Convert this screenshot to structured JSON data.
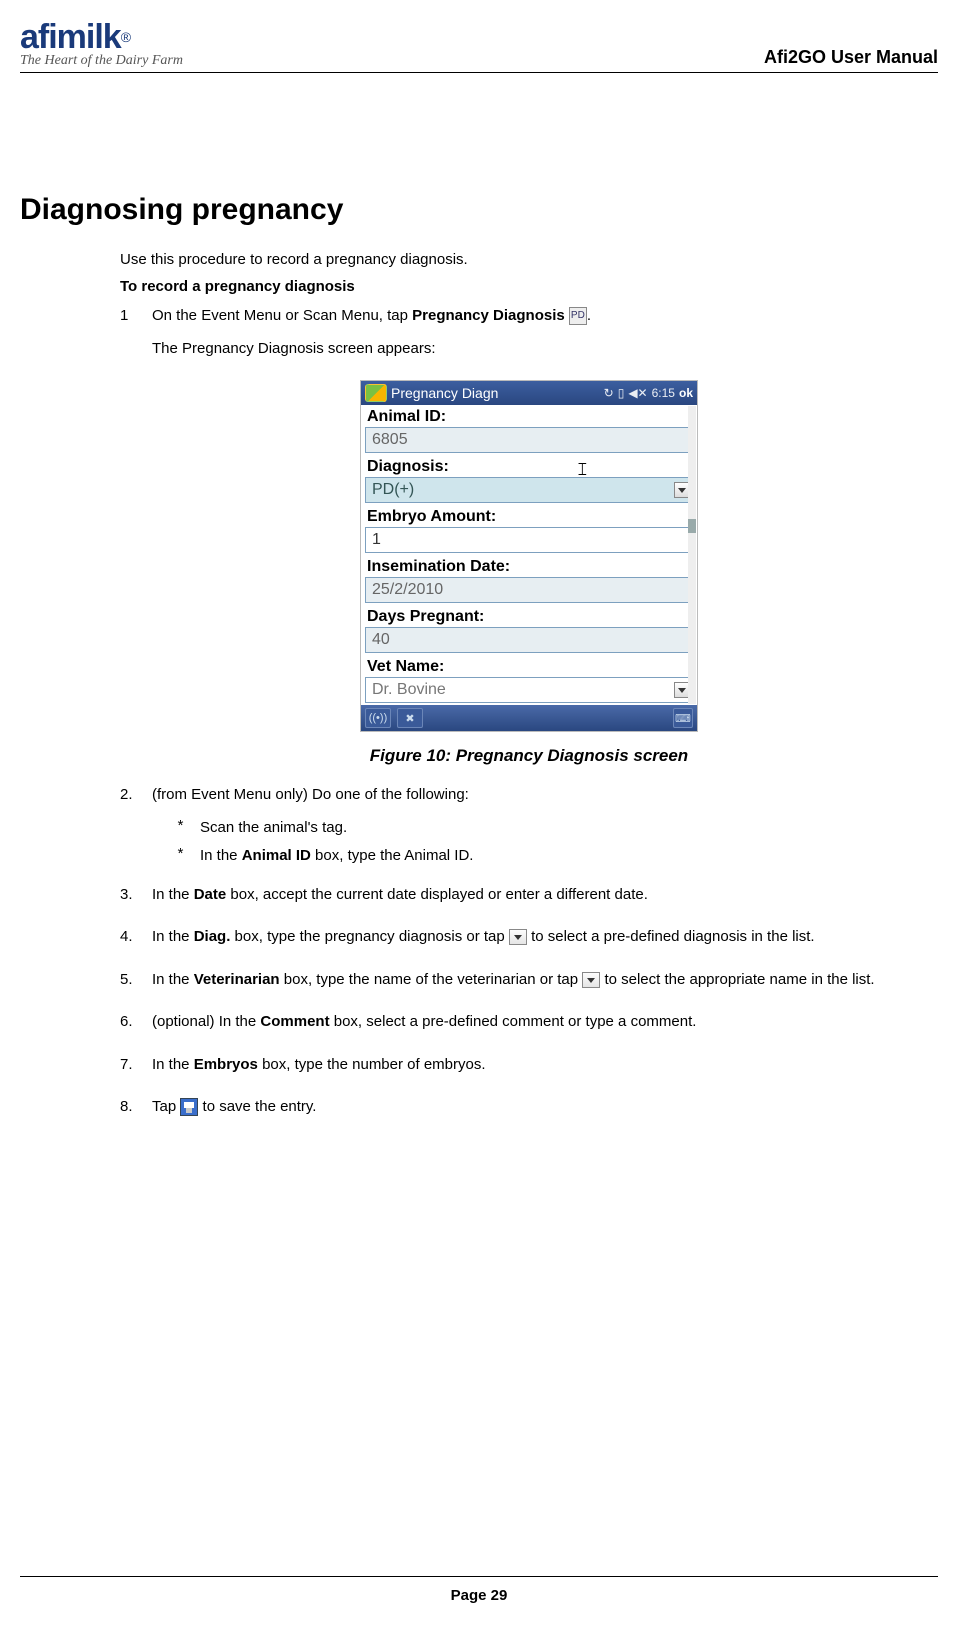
{
  "header": {
    "logo_text": "afimilk",
    "logo_reg": "®",
    "logo_tagline": "The Heart of the Dairy Farm",
    "doc_title": "Afi2GO User Manual"
  },
  "main": {
    "h1": "Diagnosing pregnancy",
    "intro": "Use this procedure to record a pregnancy diagnosis.",
    "subhead": "To record a pregnancy diagnosis",
    "step1_num": "1",
    "step1_pre": "On the Event Menu or Scan Menu, tap ",
    "step1_bold": "Pregnancy Diagnosis ",
    "step1_icon_label": "PD",
    "step1_post": ".",
    "step1_line2": "The Pregnancy Diagnosis screen appears:",
    "caption": "Figure 10: Pregnancy Diagnosis screen",
    "step2_num": "2.",
    "step2_text": "(from Event Menu only) Do one of the following:",
    "step2_b1": "Scan the animal's tag.",
    "step2_b2_pre": "In the ",
    "step2_b2_bold": "Animal ID",
    "step2_b2_post": " box, type the Animal ID.",
    "step3_num": "3.",
    "step3_pre": "In the ",
    "step3_bold": "Date",
    "step3_post": " box, accept the current date displayed or enter a different date.",
    "step4_num": "4.",
    "step4_pre": "In the ",
    "step4_bold": "Diag.",
    "step4_mid": " box, type the pregnancy diagnosis or tap ",
    "step4_post": " to select a pre-defined diagnosis in the list.",
    "step5_num": "5.",
    "step5_pre": "In the ",
    "step5_bold": "Veterinarian",
    "step5_mid": " box, type the name of the veterinarian or tap ",
    "step5_post": " to select the appropriate name in the list.",
    "step6_num": "6.",
    "step6_pre": "(optional) In the ",
    "step6_bold": "Comment",
    "step6_post": " box, select a pre-defined comment or type a comment.",
    "step7_num": "7.",
    "step7_pre": "In the ",
    "step7_bold": "Embryos",
    "step7_post": " box, type the number of embryos.",
    "step8_num": "8.",
    "step8_pre": "Tap ",
    "step8_post": " to save the entry."
  },
  "screenshot": {
    "titlebar_title": "Pregnancy Diagn",
    "titlebar_time": "6:15",
    "titlebar_ok": "ok",
    "labels": {
      "animal_id": "Animal ID:",
      "diagnosis": "Diagnosis:",
      "embryo_amount": "Embryo Amount:",
      "insemination_date": "Insemination Date:",
      "days_pregnant": "Days Pregnant:",
      "vet_name": "Vet Name:"
    },
    "values": {
      "animal_id": "6805",
      "diagnosis": "PD(+)",
      "embryo_amount": "1",
      "insemination_date": "25/2/2010",
      "days_pregnant": "40",
      "vet_name": "Dr. Bovine"
    }
  },
  "footer": {
    "page": "Page 29"
  }
}
